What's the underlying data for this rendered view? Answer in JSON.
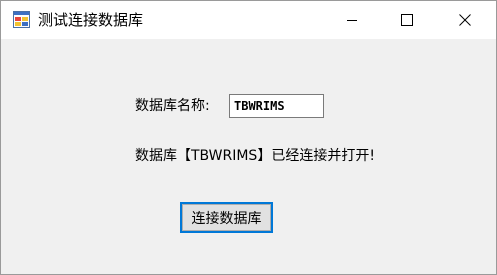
{
  "window": {
    "title": "测试连接数据库",
    "icon": "form-app-icon",
    "controls": {
      "minimize_icon": "minimize-icon",
      "maximize_icon": "maximize-icon",
      "close_icon": "close-icon"
    }
  },
  "form": {
    "name_label": "数据库名称:",
    "name_value": "TBWRIMS",
    "status_text": "数据库【TBWRIMS】已经连接并打开!",
    "connect_button_label": "连接数据库"
  },
  "colors": {
    "accent": "#0078d7",
    "client_background": "#f0f0f0",
    "titlebar_background": "#ffffff"
  }
}
